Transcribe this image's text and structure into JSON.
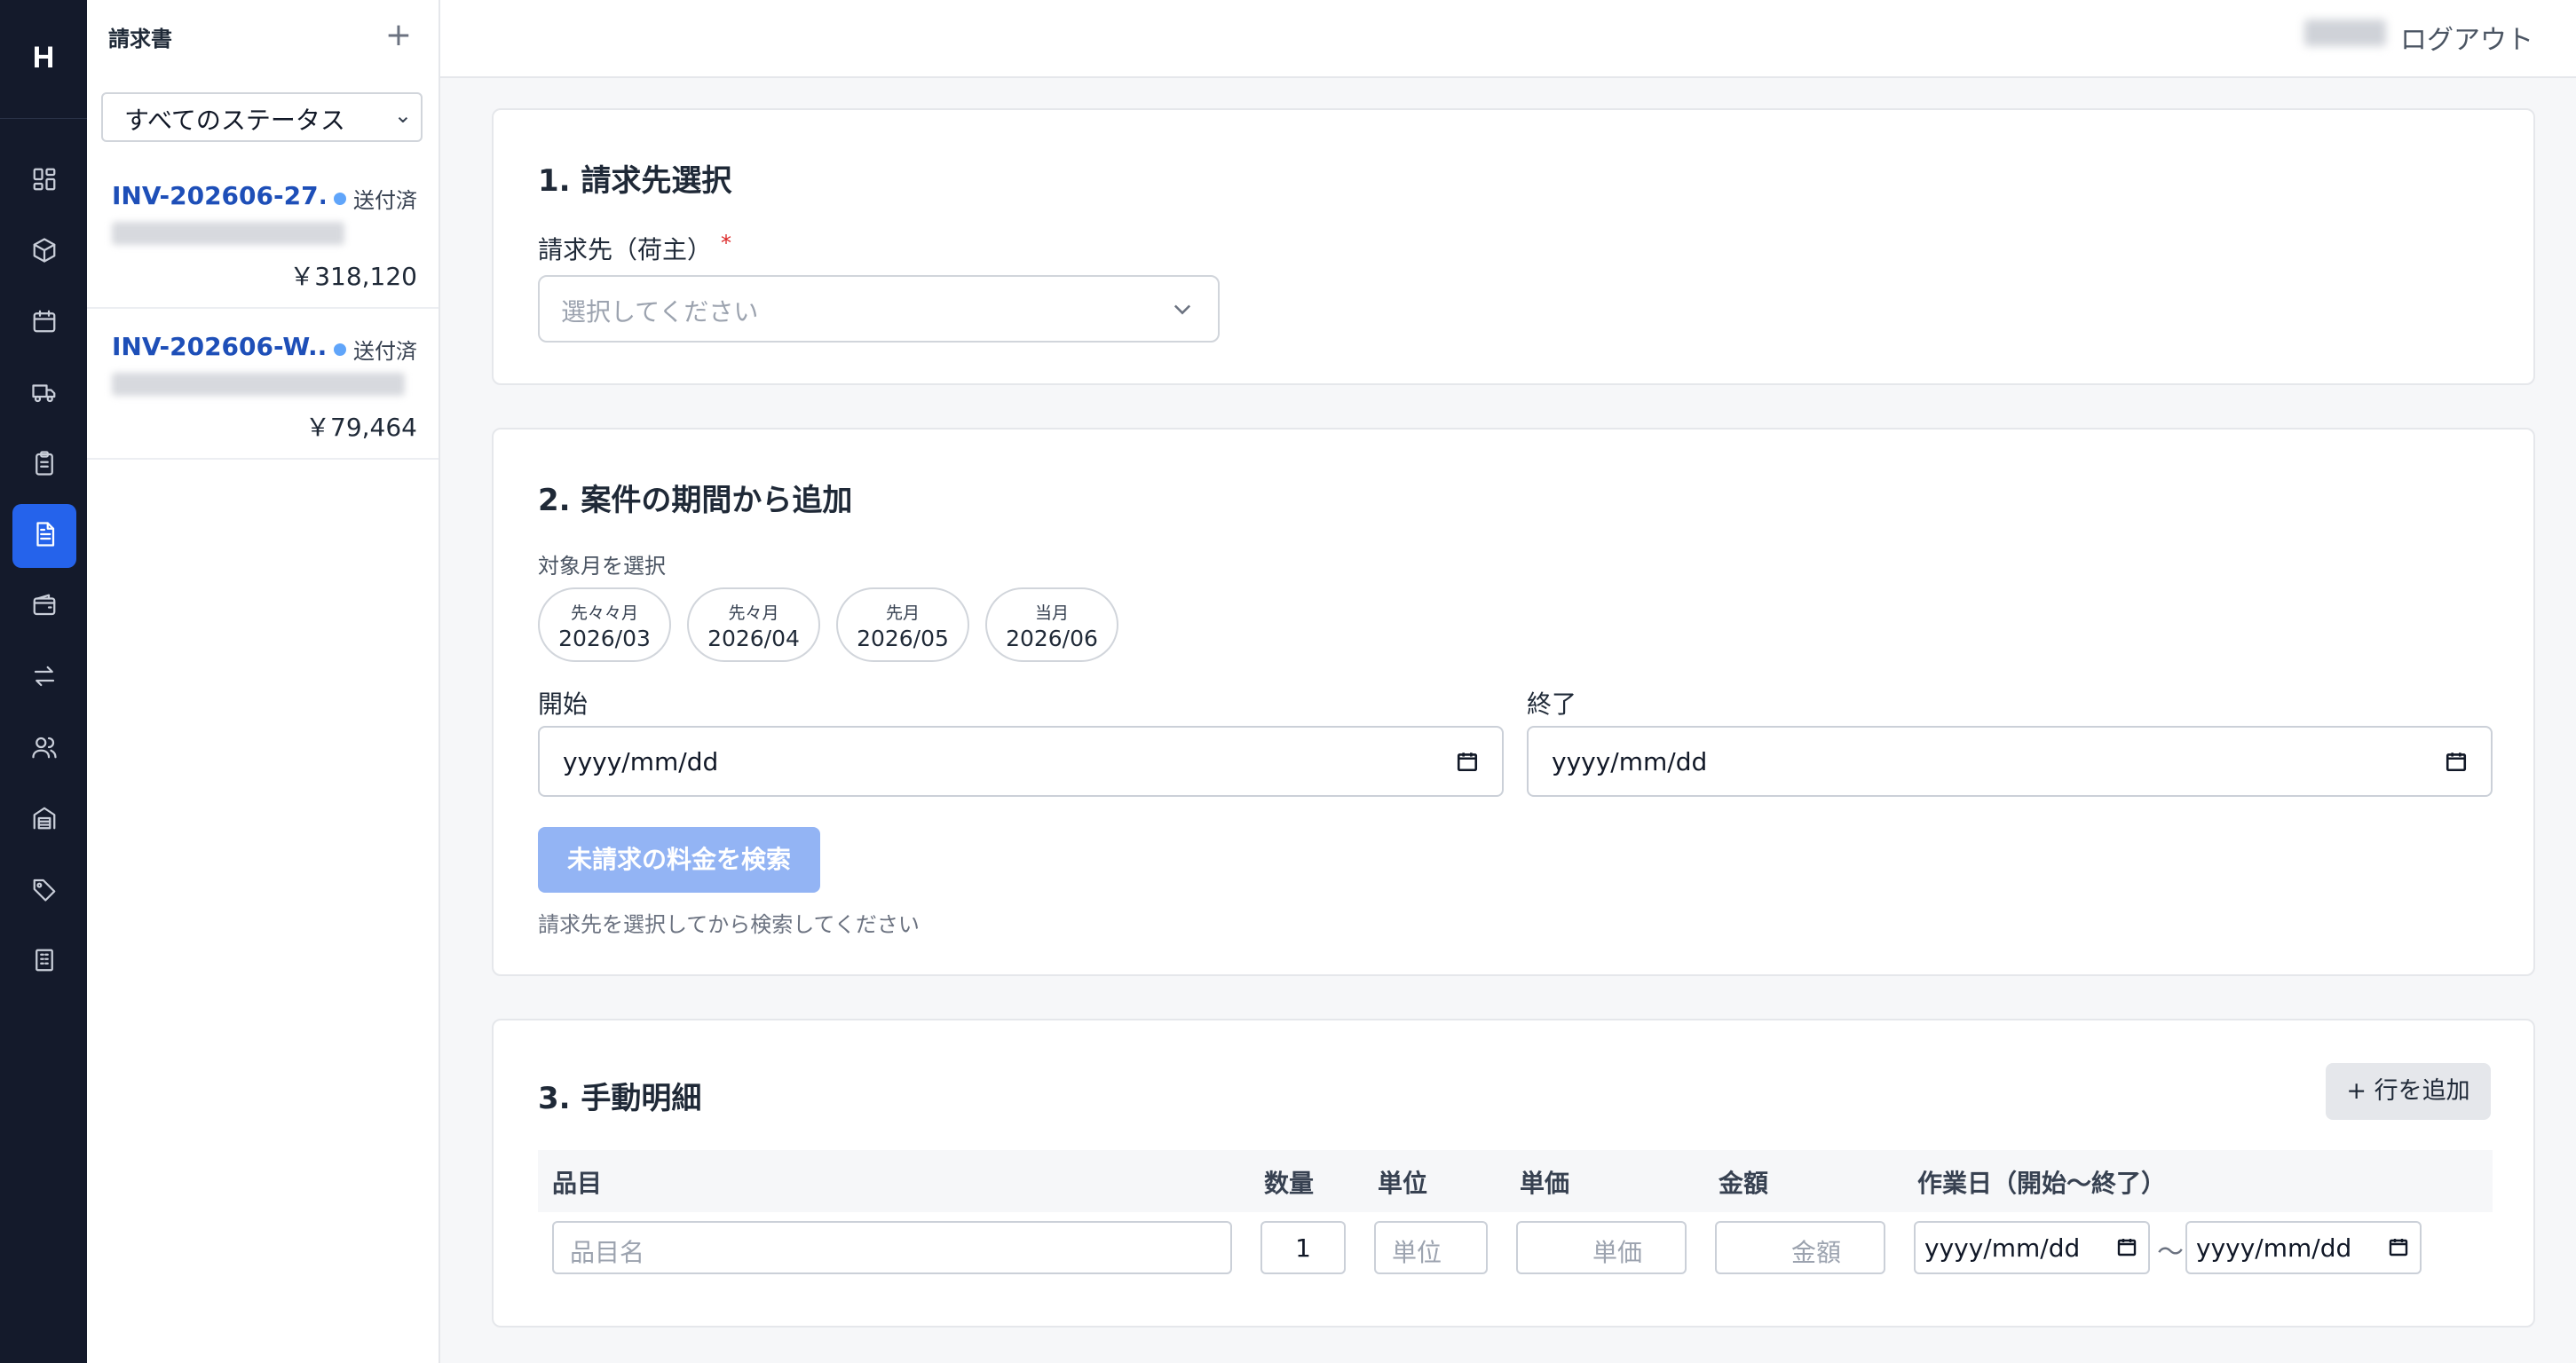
{
  "app": {
    "logo": "H"
  },
  "rail": {
    "items": [
      {
        "icon": "dashboard-icon"
      },
      {
        "icon": "box-icon"
      },
      {
        "icon": "calendar-icon"
      },
      {
        "icon": "truck-icon"
      },
      {
        "icon": "clipboard-icon"
      },
      {
        "icon": "invoice-icon",
        "active": true
      },
      {
        "icon": "wallet-icon"
      },
      {
        "icon": "transfer-icon"
      },
      {
        "icon": "users-icon"
      },
      {
        "icon": "warehouse-icon"
      },
      {
        "icon": "tag-icon"
      },
      {
        "icon": "building-icon"
      }
    ],
    "active_color": "#2563eb"
  },
  "list": {
    "title": "請求書",
    "add_label": "+",
    "status_filter": "すべてのステータス",
    "invoices": [
      {
        "number": "INV-202606-27...",
        "status": "送付済",
        "amount": "￥318,120"
      },
      {
        "number": "INV-202606-W...",
        "status": "送付済",
        "amount": "￥79,464"
      }
    ]
  },
  "topbar": {
    "logout": "ログアウト"
  },
  "section1": {
    "title": "1. 請求先選択",
    "field_label": "請求先（荷主）",
    "required_mark": "*",
    "placeholder": "選択してください"
  },
  "section2": {
    "title": "2. 案件の期間から追加",
    "month_label": "対象月を選択",
    "months": [
      {
        "caption": "先々々月",
        "value": "2026/03"
      },
      {
        "caption": "先々月",
        "value": "2026/04"
      },
      {
        "caption": "先月",
        "value": "2026/05"
      },
      {
        "caption": "当月",
        "value": "2026/06"
      }
    ],
    "start_label": "開始",
    "end_label": "終了",
    "date_placeholder": "yyyy/mm/dd",
    "search_button": "未請求の料金を検索",
    "hint": "請求先を選択してから検索してください"
  },
  "section3": {
    "title": "3. 手動明細",
    "add_row_button": "+ 行を追加",
    "columns": [
      "品目",
      "数量",
      "単位",
      "単価",
      "金額",
      "作業日（開始〜終了）"
    ],
    "row": {
      "item_placeholder": "品目名",
      "quantity": "1",
      "unit_placeholder": "単位",
      "price_placeholder": "単価",
      "amount_placeholder": "金額",
      "date_start": "yyyy/mm/dd",
      "date_separator": "〜",
      "date_end": "yyyy/mm/dd"
    }
  }
}
